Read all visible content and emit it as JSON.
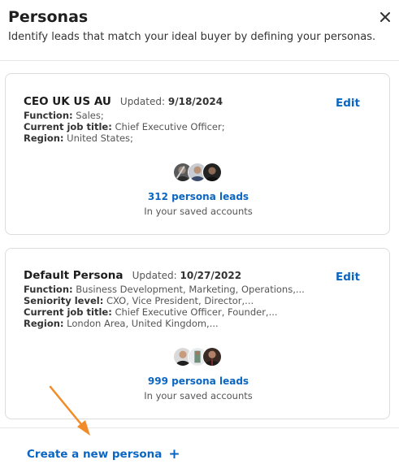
{
  "header": {
    "title": "Personas",
    "subtitle": "Identify leads that match your ideal buyer by defining your personas.",
    "close_icon": "close-icon"
  },
  "personas": [
    {
      "name": "CEO UK US AU",
      "updated_label": "Updated:",
      "updated_date": "9/18/2024",
      "edit_label": "Edit",
      "rows": [
        {
          "label": "Function:",
          "value": "Sales;"
        },
        {
          "label": "Current job title:",
          "value": "Chief Executive Officer;"
        },
        {
          "label": "Region:",
          "value": "United States;"
        }
      ],
      "leads_label": "312 persona leads",
      "saved_label": "In your saved accounts"
    },
    {
      "name": "Default Persona",
      "updated_label": "Updated:",
      "updated_date": "10/27/2022",
      "edit_label": "Edit",
      "rows": [
        {
          "label": "Function:",
          "value": "Business Development, Marketing, Operations,..."
        },
        {
          "label": "Seniority level:",
          "value": "CXO, Vice President, Director,..."
        },
        {
          "label": "Current job title:",
          "value": "Chief Executive Officer, Founder,..."
        },
        {
          "label": "Region:",
          "value": "London Area, United Kingdom,..."
        }
      ],
      "leads_label": "999 persona leads",
      "saved_label": "In your saved accounts"
    }
  ],
  "footer": {
    "create_label": "Create a new persona",
    "create_icon": "+"
  },
  "colors": {
    "accent": "#0a66c2",
    "annotation_arrow": "#f28c28"
  }
}
